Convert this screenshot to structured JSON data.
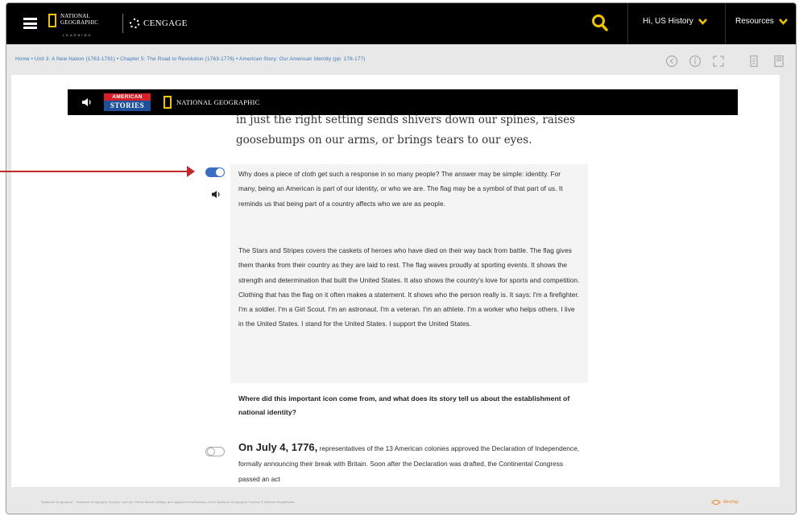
{
  "header": {
    "ng_brand_lines": [
      "NATIONAL",
      "GEOGRAPHIC"
    ],
    "ng_subtitle": "LEARNING",
    "publisher": "CENGAGE",
    "user_menu_label": "Hi, US History",
    "resources_label": "Resources"
  },
  "breadcrumb": {
    "text": "Home • Unit 3: A New Nation (1763-1791) • Chapter 5: The Road to Revolution (1763-1776) • American Story: Our American Identity (pp. 176-177)"
  },
  "banner": {
    "american_stories_top": "AMERICAN",
    "american_stories_bottom": "STORIES",
    "ng_label": "NATIONAL GEOGRAPHIC"
  },
  "article": {
    "quote": "in just the right setting sends shivers down our spines, raises goosebumps on our arms, or brings tears to our eyes.",
    "paragraph_1": "Why does a piece of cloth get such a response in so many people? The answer may be simple: identity. For many, being an American is part of our identity, or who we are. The flag may be a symbol of that part of us. It reminds us that being part of a country affects who we are as people.",
    "paragraph_2": "The Stars and Stripes covers the caskets of heroes who have died on their way back from battle. The flag gives them thanks from their country as they are laid to rest. The flag waves proudly at sporting events. It shows the strength and determination that built the United States. It also shows the country's love for sports and competition. Clothing that has the flag on it often makes a statement. It shows who the person really is. It says: I'm a firefighter. I'm a soldier. I'm a Girl Scout. I'm an astronaut. I'm a veteran. I'm an athlete. I'm a worker who helps others. I live in the United States. I stand for the United States. I support the United States.",
    "question": "Where did this important icon come from, and what does its story tell us about the establishment of national identity?",
    "paragraph_3_lead": "On July 4, 1776,",
    "paragraph_3": " representatives of the 13 American colonies approved the Declaration of Independence, formally announcing their break with Britain. Soon after the Declaration was drafted, the Continental Congress passed an act"
  },
  "footer": {
    "copyright": "\"National Geographic\", \"National Geographic Society\" and the Yellow Border Design are registered trademarks of the National Geographic Society ® Marcas Registradas",
    "mindtap_label": "MindTap"
  },
  "colors": {
    "accent_yellow": "#f1c400",
    "toggle_on": "#3a6cc4",
    "arrow": "#c1272d",
    "link": "#3b79b9"
  },
  "icons": [
    "hamburger-icon",
    "search-icon",
    "chevron-down-icon",
    "previous-icon",
    "info-icon",
    "fullscreen-icon",
    "print-icon",
    "bookmark-icon",
    "speaker-icon",
    "toggle-icon"
  ]
}
